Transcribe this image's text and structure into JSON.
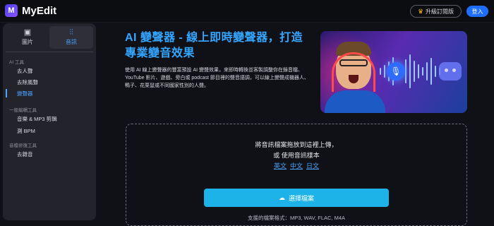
{
  "app": {
    "name": "MyEdit",
    "logo_letter": "M"
  },
  "header": {
    "upgrade_label": "升級訂閱版",
    "login_label": "登入"
  },
  "sidebar": {
    "tabs": [
      {
        "label": "圖片",
        "icon": "image-icon",
        "active": false
      },
      {
        "label": "音訊",
        "icon": "audio-wave-icon",
        "active": true
      }
    ],
    "sections": [
      {
        "heading": "AI 工具",
        "items": [
          "去人聲",
          "去除風聲",
          "變聲器"
        ]
      },
      {
        "heading": "一般編輯工具",
        "items": [
          "音樂 & MP3 剪輯",
          "測 BPM"
        ]
      },
      {
        "heading": "音檔修復工具",
        "items": [
          "去雜音"
        ]
      }
    ],
    "active_item": "變聲器"
  },
  "main": {
    "title": "AI 變聲器 - 線上即時變聲器，打造專業變音效果",
    "description": "使用 AI 線上變聲器的豐富預設 AI 變聲效果，來即時轉換並客製調整你在錄音檔、YouTube 影片、遊戲、旁白或 podcast 節目裡的聲音語調，可以線上變聲成機器人、鴨子、花栗鼠或不同國家性別的人聲。",
    "upload": {
      "line1": "將音訊檔案拖放到這裡上傳，",
      "line2": "或 使用音訊樣本",
      "sample_langs": [
        "英文",
        "中文",
        "日文"
      ],
      "choose_label": "選擇檔案",
      "formats": "支援的檔案格式：MP3, WAV, FLAC, M4A"
    }
  },
  "colors": {
    "accent": "#34a6ff",
    "button": "#1db3e8",
    "login": "#1e6fff"
  }
}
